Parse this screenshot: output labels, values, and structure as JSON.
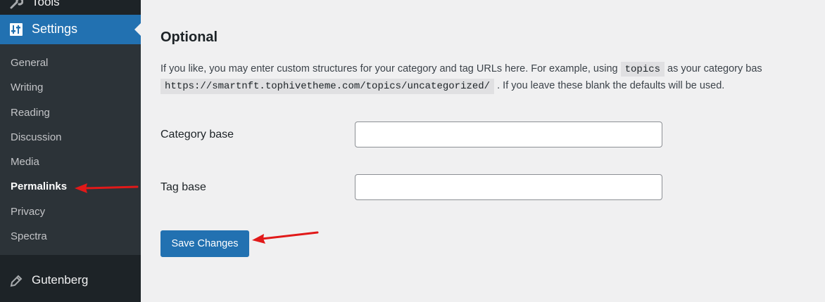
{
  "sidebar": {
    "tools_label": "Tools",
    "settings_label": "Settings",
    "submenu": [
      {
        "label": "General"
      },
      {
        "label": "Writing"
      },
      {
        "label": "Reading"
      },
      {
        "label": "Discussion"
      },
      {
        "label": "Media"
      },
      {
        "label": "Permalinks",
        "current": true
      },
      {
        "label": "Privacy"
      },
      {
        "label": "Spectra"
      }
    ],
    "gutenberg_label": "Gutenberg"
  },
  "main": {
    "section_title": "Optional",
    "description_part1": "If you like, you may enter custom structures for your category and tag URLs here. For example, using ",
    "description_code1": "topics",
    "description_part2": " as your category bas",
    "description_code2": "https://smartnft.tophivetheme.com/topics/uncategorized/",
    "description_part3": ". If you leave these blank the defaults will be used.",
    "category_base_label": "Category base",
    "category_base_value": "",
    "tag_base_label": "Tag base",
    "tag_base_value": "",
    "save_label": "Save Changes"
  },
  "colors": {
    "sidebar_bg": "#1d2327",
    "submenu_bg": "#2c3338",
    "accent": "#2271b1",
    "annotation_arrow": "#e11919"
  },
  "icons": {
    "tools": "wrench-icon",
    "settings": "settings-sliders-icon",
    "gutenberg": "pencil-icon"
  }
}
